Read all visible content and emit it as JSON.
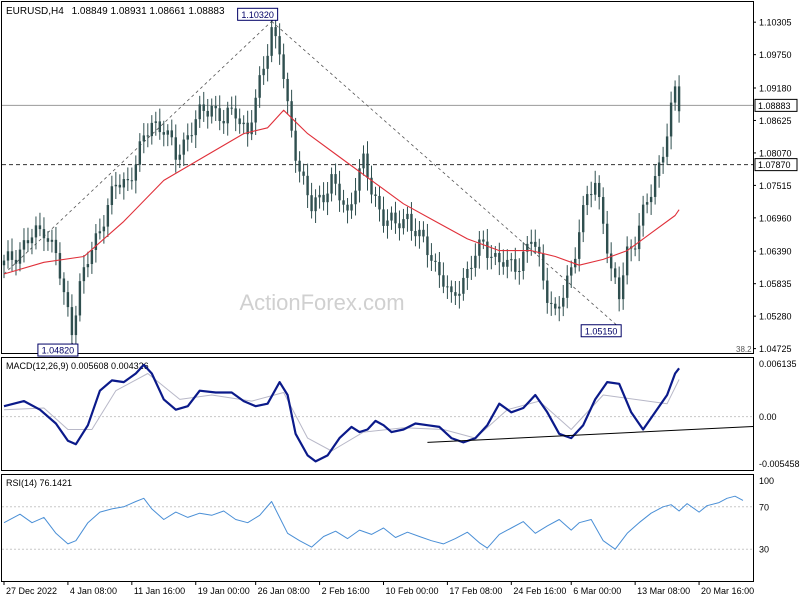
{
  "header": {
    "symbol": "EURUSD,H4",
    "ohlc": "1.08849 1.08931 1.08661 1.08883"
  },
  "watermark": "ActionForex.com",
  "colors": {
    "candle": "#2f4f4f",
    "ema": "#e0303a",
    "macd_line": "#0b1a8a",
    "macd_signal": "#b8b8c8",
    "rsi": "#4a8fd6",
    "grid": "#c8c8c8",
    "trendline": "#555555",
    "border": "#000000"
  },
  "chart_data": [
    {
      "type": "candlestick",
      "panel": "price",
      "symbol": "EURUSD",
      "timeframe": "H4",
      "ylim": [
        1.0465,
        1.1065
      ],
      "y_ticks": [
        "1.10305",
        "1.09750",
        "1.09180",
        "1.08625",
        "1.08070",
        "1.07515",
        "1.06960",
        "1.06390",
        "1.05835",
        "1.05280",
        "1.04725"
      ],
      "y_tick_values": [
        1.10305,
        1.0975,
        1.0918,
        1.08625,
        1.0807,
        1.07515,
        1.0696,
        1.0639,
        1.05835,
        1.0528,
        1.04725
      ],
      "x_ticks": [
        "27 Dec 2022",
        "4 Jan 08:00",
        "11 Jan 16:00",
        "19 Jan 00:00",
        "26 Jan 08:00",
        "2 Feb 16:00",
        "10 Feb 00:00",
        "17 Feb 08:00",
        "24 Feb 16:00",
        "6 Mar 00:00",
        "13 Mar 08:00",
        "20 Mar 16:00"
      ],
      "close_path": [
        [
          0,
          1.0615
        ],
        [
          5,
          1.065
        ],
        [
          10,
          1.068
        ],
        [
          13,
          1.0632
        ],
        [
          15,
          1.056
        ],
        [
          17,
          1.051
        ],
        [
          19,
          1.058
        ],
        [
          22,
          1.064
        ],
        [
          25,
          1.07
        ],
        [
          28,
          1.075
        ],
        [
          31,
          1.076
        ],
        [
          34,
          1.081
        ],
        [
          37,
          1.086
        ],
        [
          40,
          1.085
        ],
        [
          43,
          1.08
        ],
        [
          46,
          1.084
        ],
        [
          49,
          1.087
        ],
        [
          52,
          1.089
        ],
        [
          55,
          1.086
        ],
        [
          58,
          1.088
        ],
        [
          61,
          1.084
        ],
        [
          63,
          1.089
        ],
        [
          65,
          1.096
        ],
        [
          67,
          1.102
        ],
        [
          69,
          1.098
        ],
        [
          71,
          1.088
        ],
        [
          74,
          1.078
        ],
        [
          77,
          1.071
        ],
        [
          80,
          1.074
        ],
        [
          82,
          1.076
        ],
        [
          84,
          1.073
        ],
        [
          86,
          1.07
        ],
        [
          88,
          1.076
        ],
        [
          90,
          1.079
        ],
        [
          92,
          1.074
        ],
        [
          95,
          1.07
        ],
        [
          98,
          1.068
        ],
        [
          101,
          1.07
        ],
        [
          104,
          1.066
        ],
        [
          107,
          1.063
        ],
        [
          110,
          1.059
        ],
        [
          112,
          1.055
        ],
        [
          114,
          1.058
        ],
        [
          117,
          1.062
        ],
        [
          120,
          1.065
        ],
        [
          123,
          1.063
        ],
        [
          126,
          1.061
        ],
        [
          129,
          1.062
        ],
        [
          132,
          1.066
        ],
        [
          134,
          1.062
        ],
        [
          136,
          1.057
        ],
        [
          138,
          1.053
        ],
        [
          140,
          1.056
        ],
        [
          142,
          1.061
        ],
        [
          144,
          1.068
        ],
        [
          146,
          1.073
        ],
        [
          148,
          1.075
        ],
        [
          150,
          1.07
        ],
        [
          152,
          1.06
        ],
        [
          154,
          1.056
        ],
        [
          156,
          1.064
        ],
        [
          158,
          1.066
        ],
        [
          160,
          1.07
        ],
        [
          162,
          1.074
        ],
        [
          164,
          1.079
        ],
        [
          166,
          1.084
        ],
        [
          168,
          1.091
        ],
        [
          169,
          1.0888
        ]
      ],
      "ema_path": [
        [
          0,
          1.06
        ],
        [
          10,
          1.062
        ],
        [
          20,
          1.063
        ],
        [
          30,
          1.069
        ],
        [
          40,
          1.076
        ],
        [
          50,
          1.08
        ],
        [
          60,
          1.084
        ],
        [
          66,
          1.085
        ],
        [
          70,
          1.088
        ],
        [
          76,
          1.084
        ],
        [
          84,
          1.08
        ],
        [
          92,
          1.076
        ],
        [
          100,
          1.072
        ],
        [
          108,
          1.069
        ],
        [
          116,
          1.066
        ],
        [
          124,
          1.064
        ],
        [
          132,
          1.064
        ],
        [
          138,
          1.063
        ],
        [
          144,
          1.0615
        ],
        [
          150,
          1.0625
        ],
        [
          156,
          1.064
        ],
        [
          162,
          1.067
        ],
        [
          168,
          1.07
        ],
        [
          169,
          1.071
        ]
      ],
      "annotations": [
        {
          "label": "1.10320",
          "x": 67,
          "y": 1.1032,
          "kind": "swing-high"
        },
        {
          "label": "1.04820",
          "x": 17,
          "y": 1.0482,
          "kind": "swing-low"
        },
        {
          "label": "1.05150",
          "x": 153,
          "y": 1.0515,
          "kind": "swing-low"
        }
      ],
      "price_markers": [
        {
          "label": "1.08883",
          "value": 1.08883,
          "style": "solid"
        },
        {
          "label": "1.07870",
          "value": 1.0787,
          "style": "dashed"
        }
      ],
      "fib_label": "38.2",
      "trendlines": [
        {
          "from": [
            0,
            1.06
          ],
          "to": [
            67,
            1.1032
          ],
          "style": "dashed"
        },
        {
          "from": [
            67,
            1.1032
          ],
          "to": [
            153,
            1.0515
          ],
          "style": "dashed"
        }
      ]
    },
    {
      "type": "line",
      "panel": "macd",
      "title": "MACD(12,26,9) 0.005608 0.004326",
      "ylim": [
        -0.0062,
        0.0068
      ],
      "y_ticks": [
        "0.006135",
        "0.00",
        "-0.005458"
      ],
      "y_tick_values": [
        0.006135,
        0.0,
        -0.005458
      ],
      "macd_path": [
        [
          0,
          0.0012
        ],
        [
          5,
          0.0018
        ],
        [
          9,
          0.0008
        ],
        [
          13,
          -0.0008
        ],
        [
          16,
          -0.0028
        ],
        [
          18,
          -0.0032
        ],
        [
          21,
          -0.001
        ],
        [
          24,
          0.003
        ],
        [
          27,
          0.0042
        ],
        [
          30,
          0.004
        ],
        [
          33,
          0.005
        ],
        [
          35,
          0.006
        ],
        [
          37,
          0.005
        ],
        [
          40,
          0.002
        ],
        [
          43,
          0.0008
        ],
        [
          46,
          0.0012
        ],
        [
          49,
          0.003
        ],
        [
          53,
          0.0028
        ],
        [
          57,
          0.0028
        ],
        [
          60,
          0.0018
        ],
        [
          63,
          0.0012
        ],
        [
          66,
          0.0015
        ],
        [
          69,
          0.004
        ],
        [
          71,
          0.0025
        ],
        [
          73,
          -0.002
        ],
        [
          76,
          -0.0045
        ],
        [
          78,
          -0.0052
        ],
        [
          81,
          -0.0045
        ],
        [
          84,
          -0.0025
        ],
        [
          87,
          -0.0012
        ],
        [
          89,
          -0.0018
        ],
        [
          91,
          -0.0015
        ],
        [
          93,
          -0.0005
        ],
        [
          95,
          -0.001
        ],
        [
          97,
          -0.0018
        ],
        [
          100,
          -0.0015
        ],
        [
          103,
          -0.0008
        ],
        [
          106,
          -0.001
        ],
        [
          109,
          -0.0012
        ],
        [
          112,
          -0.0025
        ],
        [
          115,
          -0.003
        ],
        [
          118,
          -0.0025
        ],
        [
          121,
          -0.001
        ],
        [
          124,
          0.0015
        ],
        [
          127,
          0.0005
        ],
        [
          130,
          0.001
        ],
        [
          133,
          0.0025
        ],
        [
          136,
          0.0005
        ],
        [
          139,
          -0.002
        ],
        [
          142,
          -0.0025
        ],
        [
          145,
          -0.001
        ],
        [
          148,
          0.002
        ],
        [
          151,
          0.004
        ],
        [
          154,
          0.0038
        ],
        [
          157,
          0.0005
        ],
        [
          160,
          -0.0015
        ],
        [
          163,
          0.0005
        ],
        [
          166,
          0.0025
        ],
        [
          168,
          0.005
        ],
        [
          169,
          0.0056
        ]
      ],
      "signal_path": [
        [
          0,
          0.0008
        ],
        [
          10,
          0.001
        ],
        [
          16,
          -0.0015
        ],
        [
          22,
          -0.0015
        ],
        [
          28,
          0.003
        ],
        [
          36,
          0.005
        ],
        [
          44,
          0.002
        ],
        [
          52,
          0.0025
        ],
        [
          62,
          0.0018
        ],
        [
          70,
          0.0028
        ],
        [
          76,
          -0.0025
        ],
        [
          82,
          -0.004
        ],
        [
          90,
          -0.0018
        ],
        [
          100,
          -0.0013
        ],
        [
          110,
          -0.0015
        ],
        [
          118,
          -0.0025
        ],
        [
          126,
          0.0008
        ],
        [
          134,
          0.0018
        ],
        [
          142,
          -0.0015
        ],
        [
          150,
          0.0025
        ],
        [
          158,
          0.002
        ],
        [
          166,
          0.0015
        ],
        [
          169,
          0.0043
        ]
      ],
      "trendline": {
        "from": [
          106,
          -0.003
        ],
        "to": [
          169,
          -0.0015
        ]
      }
    },
    {
      "type": "line",
      "panel": "rsi",
      "title": "RSI(14) 76.1421",
      "ylim": [
        0,
        100
      ],
      "y_ticks": [
        "100",
        "70",
        "30"
      ],
      "y_tick_values": [
        100,
        70,
        30
      ],
      "rsi_path": [
        [
          0,
          55
        ],
        [
          4,
          63
        ],
        [
          7,
          55
        ],
        [
          10,
          60
        ],
        [
          13,
          45
        ],
        [
          16,
          35
        ],
        [
          18,
          38
        ],
        [
          21,
          55
        ],
        [
          24,
          65
        ],
        [
          27,
          68
        ],
        [
          30,
          70
        ],
        [
          33,
          75
        ],
        [
          35,
          78
        ],
        [
          37,
          68
        ],
        [
          40,
          58
        ],
        [
          43,
          65
        ],
        [
          46,
          60
        ],
        [
          49,
          64
        ],
        [
          52,
          62
        ],
        [
          55,
          66
        ],
        [
          58,
          58
        ],
        [
          61,
          55
        ],
        [
          64,
          62
        ],
        [
          67,
          75
        ],
        [
          69,
          60
        ],
        [
          71,
          45
        ],
        [
          74,
          38
        ],
        [
          77,
          32
        ],
        [
          80,
          42
        ],
        [
          83,
          47
        ],
        [
          86,
          40
        ],
        [
          89,
          48
        ],
        [
          92,
          44
        ],
        [
          95,
          50
        ],
        [
          98,
          41
        ],
        [
          101,
          46
        ],
        [
          104,
          42
        ],
        [
          107,
          38
        ],
        [
          110,
          35
        ],
        [
          113,
          40
        ],
        [
          116,
          46
        ],
        [
          119,
          36
        ],
        [
          121,
          31
        ],
        [
          124,
          44
        ],
        [
          127,
          50
        ],
        [
          130,
          56
        ],
        [
          133,
          45
        ],
        [
          136,
          52
        ],
        [
          139,
          58
        ],
        [
          142,
          48
        ],
        [
          144,
          55
        ],
        [
          147,
          58
        ],
        [
          150,
          38
        ],
        [
          153,
          30
        ],
        [
          156,
          45
        ],
        [
          159,
          55
        ],
        [
          162,
          64
        ],
        [
          165,
          70
        ],
        [
          167,
          72
        ],
        [
          169,
          66
        ],
        [
          171,
          73
        ],
        [
          174,
          65
        ],
        [
          176,
          71
        ],
        [
          179,
          74
        ],
        [
          181,
          78
        ],
        [
          183,
          80
        ],
        [
          185,
          76
        ]
      ]
    }
  ]
}
